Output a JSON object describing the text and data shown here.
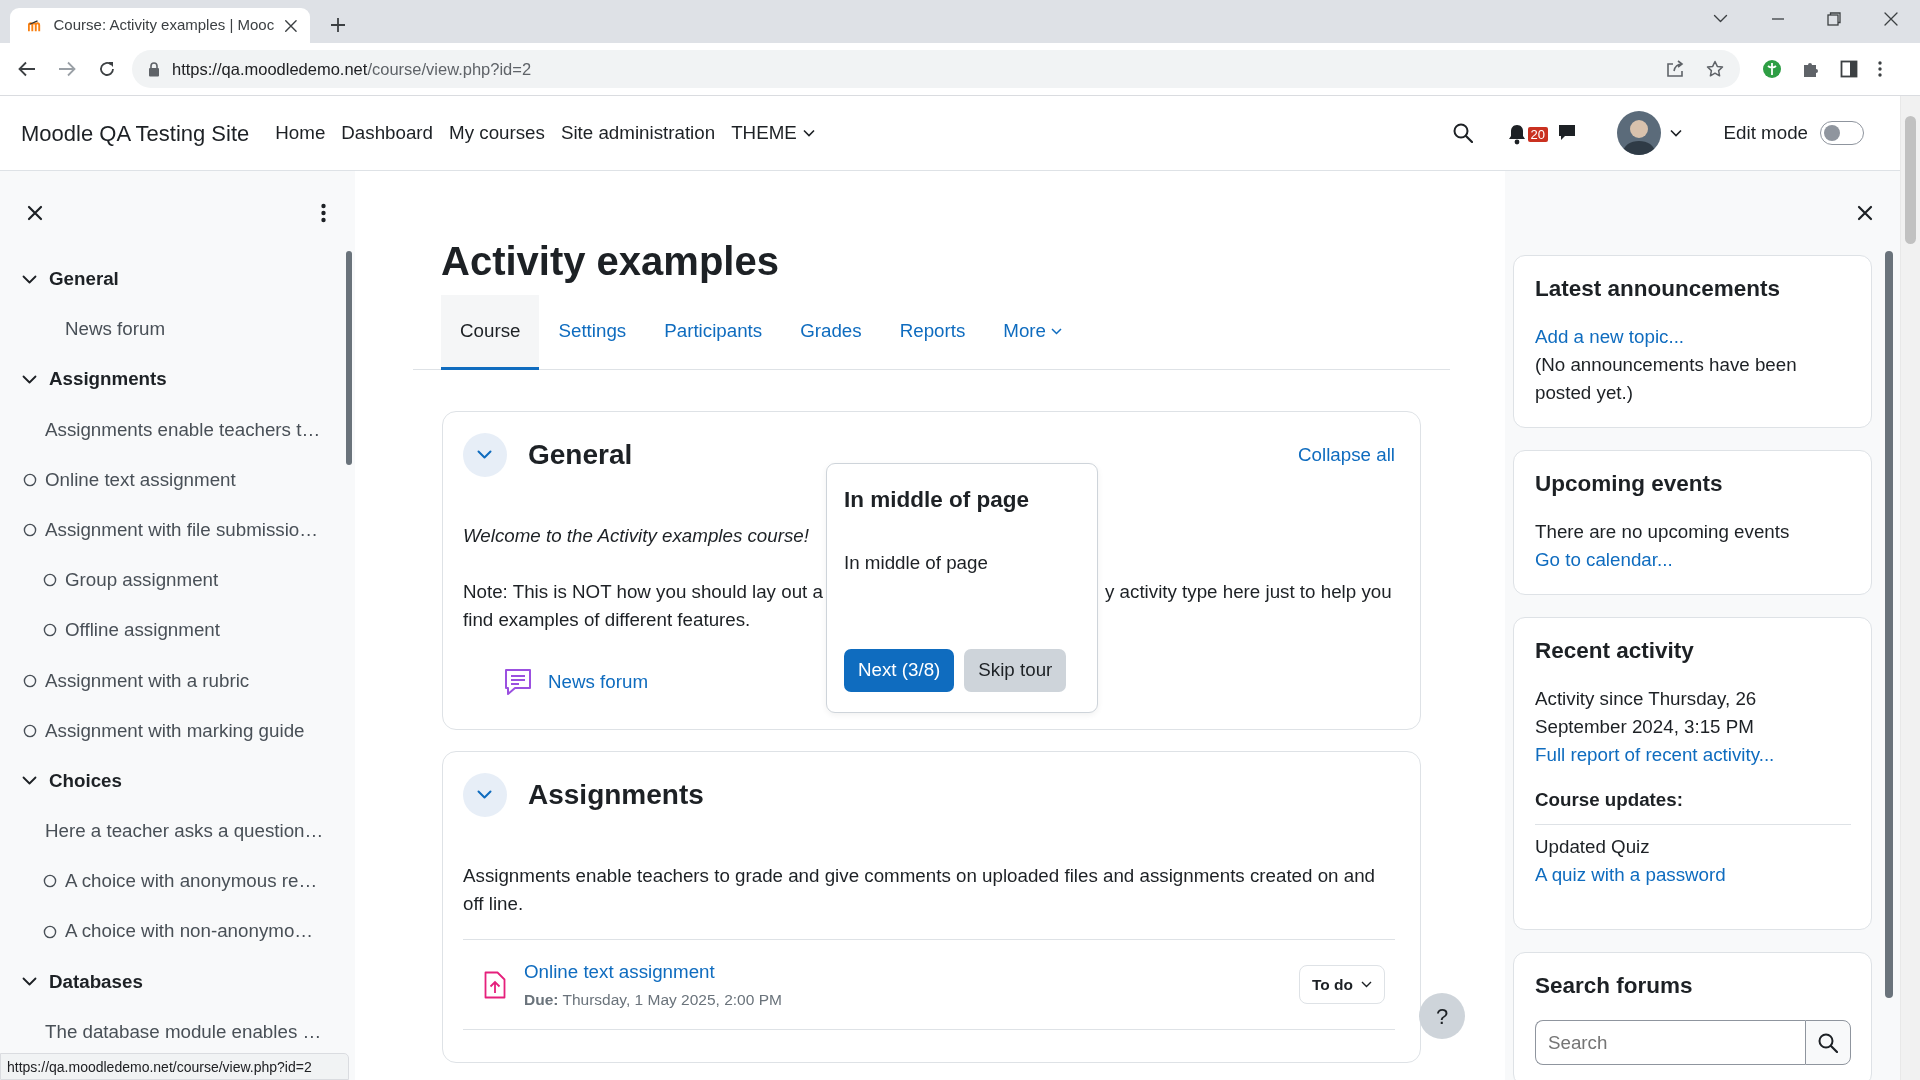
{
  "browser": {
    "tab_title": "Course: Activity examples | Mooc",
    "address": {
      "origin": "https://qa.moodledemo.net",
      "path": "/course/view.php?id=2"
    },
    "status_url": "https://qa.moodledemo.net/course/view.php?id=2"
  },
  "navbar": {
    "brand": "Moodle QA Testing Site",
    "links": [
      {
        "label": "Home",
        "dropdown": false
      },
      {
        "label": "Dashboard",
        "dropdown": false
      },
      {
        "label": "My courses",
        "dropdown": false
      },
      {
        "label": "Site administration",
        "dropdown": false
      },
      {
        "label": "THEME",
        "dropdown": true
      }
    ],
    "notification_count": "20",
    "edit_mode": {
      "label": "Edit mode",
      "on": false
    }
  },
  "course_index": {
    "sections": [
      {
        "title": "General",
        "expanded": true,
        "items": [
          {
            "label": "News forum",
            "indented": true,
            "completion": false
          }
        ]
      },
      {
        "title": "Assignments",
        "expanded": true,
        "items": [
          {
            "label": "Assignments enable teachers t…",
            "indented": false,
            "completion": false
          },
          {
            "label": "Online text assignment",
            "indented": false,
            "completion": true
          },
          {
            "label": "Assignment with file submissio…",
            "indented": false,
            "completion": true
          },
          {
            "label": "Group assignment",
            "indented": true,
            "completion": true
          },
          {
            "label": "Offline assignment",
            "indented": true,
            "completion": true
          },
          {
            "label": "Assignment with a rubric",
            "indented": false,
            "completion": true
          },
          {
            "label": "Assignment with marking guide",
            "indented": false,
            "completion": true
          }
        ]
      },
      {
        "title": "Choices",
        "expanded": true,
        "items": [
          {
            "label": "Here a teacher asks a question…",
            "indented": false,
            "completion": false
          },
          {
            "label": "A choice with anonymous re…",
            "indented": true,
            "completion": true
          },
          {
            "label": "A choice with non-anonymo…",
            "indented": true,
            "completion": true
          }
        ]
      },
      {
        "title": "Databases",
        "expanded": true,
        "items": [
          {
            "label": "The database module enables …",
            "indented": false,
            "completion": false
          }
        ]
      }
    ]
  },
  "main": {
    "title": "Activity examples",
    "tabs": [
      {
        "label": "Course",
        "selected": true,
        "dropdown": false
      },
      {
        "label": "Settings",
        "selected": false,
        "dropdown": false
      },
      {
        "label": "Participants",
        "selected": false,
        "dropdown": false
      },
      {
        "label": "Grades",
        "selected": false,
        "dropdown": false
      },
      {
        "label": "Reports",
        "selected": false,
        "dropdown": false
      },
      {
        "label": "More",
        "selected": false,
        "dropdown": true
      }
    ],
    "sections": [
      {
        "title": "General",
        "expanded": true,
        "action": "Collapse all",
        "summary": [
          {
            "kind": "italic",
            "lines": [
              [
                "Welcome to the Activity examples course!"
              ]
            ]
          },
          {
            "kind": "plain",
            "lines": [
              [
                "Note: This is NOT how you should lay out a",
                "y activity type here just to help you"
              ],
              [
                "find examples of different features."
              ]
            ]
          }
        ],
        "activities": [
          {
            "kind": "forum",
            "name": "News forum"
          }
        ]
      },
      {
        "title": "Assignments",
        "expanded": true,
        "summary": [
          {
            "kind": "plain",
            "lines": [
              [
                "Assignments enable teachers to grade and give comments on uploaded files and assignments created on and off line."
              ]
            ]
          }
        ],
        "activities": [
          {
            "kind": "assign",
            "name": "Online text assignment",
            "due": "**Due:** Thursday, 1 May 2025, 2:00 PM",
            "status": "To do"
          }
        ]
      }
    ]
  },
  "tour": {
    "title": "In middle of page",
    "body": "In middle of page",
    "buttons": [
      {
        "label": "Next (3/8)",
        "kind": "primary"
      },
      {
        "label": "Skip tour",
        "kind": "secondary"
      }
    ]
  },
  "help_button": "?",
  "blocks": [
    {
      "title": "Latest announcements",
      "content": [
        {
          "kind": "link",
          "text": "Add a new topic..."
        },
        {
          "kind": "text",
          "text": "(No announcements have been posted yet.)"
        }
      ]
    },
    {
      "title": "Upcoming events",
      "content": [
        {
          "kind": "text",
          "text": "There are no upcoming events"
        },
        {
          "kind": "link",
          "text": "Go to calendar..."
        }
      ]
    },
    {
      "title": "Recent activity",
      "content": [
        {
          "kind": "text",
          "text": "Activity since Thursday, 26 September 2024, 3:15 PM"
        },
        {
          "kind": "link",
          "text": "Full report of recent activity..."
        },
        {
          "kind": "subheading",
          "text": "Course updates:"
        },
        {
          "kind": "text",
          "text": "Updated Quiz"
        },
        {
          "kind": "link",
          "text": "A quiz with a password"
        }
      ]
    },
    {
      "title": "Search forums",
      "search": {
        "placeholder": "Search"
      }
    }
  ]
}
